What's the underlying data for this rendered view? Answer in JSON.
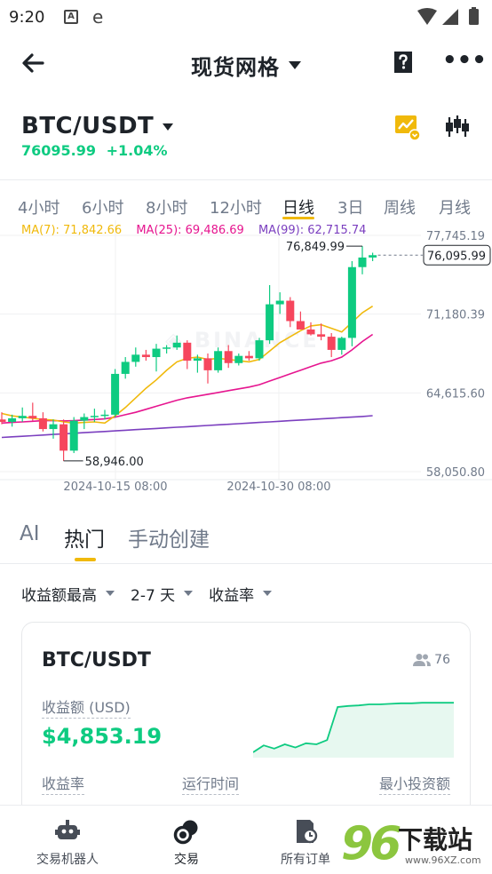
{
  "status_bar": {
    "time": "9:20",
    "icon_a": "A",
    "icon_e": "e"
  },
  "nav": {
    "title": "现货网格"
  },
  "pair": {
    "name": "BTC/USDT",
    "price": "76095.99",
    "change": "+1.04%"
  },
  "intervals": [
    "4小时",
    "6小时",
    "8小时",
    "12小时",
    "日线",
    "3日",
    "周线",
    "月线"
  ],
  "active_interval": "日线",
  "ma": {
    "ma7": "MA(7): 71,842.66",
    "ma25": "MA(25): 69,486.69",
    "ma99": "MA(99): 62,715.74",
    "colors": {
      "ma7": "#f0b90b",
      "ma25": "#e6158f",
      "ma99": "#7b3fbf"
    }
  },
  "chart_data": {
    "type": "candlestick",
    "y_ticks": [
      "77,745.19",
      "71,180.39",
      "64,615.60",
      "58,050.80"
    ],
    "x_ticks": [
      "2024-10-15 08:00",
      "2024-10-30 08:00"
    ],
    "high_label": "76,849.99",
    "low_label": "58,946.00",
    "last_price_label": "76,095.99",
    "watermark": "BINANCE",
    "ylim": [
      58050.8,
      77745.19
    ],
    "colors": {
      "up": "#0ecb81",
      "down": "#f6465d"
    },
    "candles": [
      {
        "o": 62400,
        "h": 63000,
        "l": 62000,
        "c": 62200
      },
      {
        "o": 62200,
        "h": 62800,
        "l": 61800,
        "c": 62500
      },
      {
        "o": 62500,
        "h": 63400,
        "l": 62200,
        "c": 62700
      },
      {
        "o": 62700,
        "h": 63800,
        "l": 62300,
        "c": 62500
      },
      {
        "o": 62500,
        "h": 63000,
        "l": 61400,
        "c": 61600
      },
      {
        "o": 61600,
        "h": 62400,
        "l": 60800,
        "c": 62000
      },
      {
        "o": 62000,
        "h": 62400,
        "l": 58946,
        "c": 59800
      },
      {
        "o": 59800,
        "h": 62600,
        "l": 59600,
        "c": 62300
      },
      {
        "o": 62300,
        "h": 62900,
        "l": 61600,
        "c": 62600
      },
      {
        "o": 62600,
        "h": 63300,
        "l": 62200,
        "c": 62700
      },
      {
        "o": 62700,
        "h": 63200,
        "l": 62400,
        "c": 62800
      },
      {
        "o": 62800,
        "h": 66600,
        "l": 62600,
        "c": 66200
      },
      {
        "o": 66200,
        "h": 67600,
        "l": 65800,
        "c": 67200
      },
      {
        "o": 67200,
        "h": 68400,
        "l": 66800,
        "c": 67800
      },
      {
        "o": 67800,
        "h": 68200,
        "l": 67300,
        "c": 67600
      },
      {
        "o": 67600,
        "h": 68700,
        "l": 66400,
        "c": 68300
      },
      {
        "o": 68300,
        "h": 68600,
        "l": 67900,
        "c": 68400
      },
      {
        "o": 68400,
        "h": 69400,
        "l": 68200,
        "c": 68800
      },
      {
        "o": 68800,
        "h": 69000,
        "l": 66600,
        "c": 67300
      },
      {
        "o": 67300,
        "h": 67800,
        "l": 66300,
        "c": 67500
      },
      {
        "o": 67500,
        "h": 67900,
        "l": 65400,
        "c": 66500
      },
      {
        "o": 66500,
        "h": 68400,
        "l": 66300,
        "c": 68100
      },
      {
        "o": 68100,
        "h": 68600,
        "l": 66700,
        "c": 67100
      },
      {
        "o": 67100,
        "h": 67900,
        "l": 66900,
        "c": 67700
      },
      {
        "o": 67700,
        "h": 68100,
        "l": 67300,
        "c": 67500
      },
      {
        "o": 67500,
        "h": 69200,
        "l": 67300,
        "c": 69000
      },
      {
        "o": 69000,
        "h": 73600,
        "l": 68700,
        "c": 72000
      },
      {
        "o": 72000,
        "h": 73000,
        "l": 71200,
        "c": 72300
      },
      {
        "o": 72300,
        "h": 72600,
        "l": 70100,
        "c": 70600
      },
      {
        "o": 70600,
        "h": 71400,
        "l": 69900,
        "c": 69900
      },
      {
        "o": 69900,
        "h": 70500,
        "l": 69400,
        "c": 69500
      },
      {
        "o": 69500,
        "h": 70400,
        "l": 69000,
        "c": 69300
      },
      {
        "o": 69300,
        "h": 69600,
        "l": 67600,
        "c": 68200
      },
      {
        "o": 68200,
        "h": 69300,
        "l": 67800,
        "c": 69200
      },
      {
        "o": 69200,
        "h": 75600,
        "l": 68500,
        "c": 75100
      },
      {
        "o": 75100,
        "h": 76849.99,
        "l": 74500,
        "c": 75900
      },
      {
        "o": 75900,
        "h": 76300,
        "l": 75600,
        "c": 76095.99
      }
    ],
    "ma7": [
      62900,
      62700,
      62600,
      62500,
      62400,
      62350,
      62200,
      62100,
      62150,
      62200,
      62100,
      62700,
      63400,
      64200,
      65000,
      65700,
      66500,
      67200,
      67500,
      67600,
      67400,
      67500,
      67400,
      67300,
      67200,
      67400,
      68100,
      68800,
      69300,
      69800,
      70200,
      70300,
      70000,
      69700,
      70500,
      71300,
      71842.66
    ],
    "ma25": [
      62100,
      62150,
      62200,
      62250,
      62300,
      62300,
      62280,
      62300,
      62350,
      62400,
      62450,
      62600,
      62800,
      63000,
      63250,
      63500,
      63750,
      64000,
      64200,
      64350,
      64500,
      64650,
      64800,
      64950,
      65100,
      65300,
      65600,
      65900,
      66200,
      66500,
      66800,
      67100,
      67300,
      67600,
      68200,
      68900,
      69486.69
    ],
    "ma99": [
      60900,
      60950,
      61000,
      61050,
      61100,
      61150,
      61200,
      61250,
      61300,
      61350,
      61400,
      61450,
      61500,
      61550,
      61600,
      61650,
      61700,
      61750,
      61800,
      61850,
      61900,
      61950,
      62000,
      62050,
      62100,
      62150,
      62200,
      62250,
      62300,
      62350,
      62400,
      62450,
      62500,
      62550,
      62600,
      62650,
      62715.74
    ]
  },
  "tabs": [
    "AI",
    "热门",
    "手动创建"
  ],
  "active_tab": "热门",
  "filters": [
    "收益额最高",
    "2-7 天",
    "收益率"
  ],
  "card": {
    "pair": "BTC/USDT",
    "users": "76",
    "profit_label": "收益额 (USD)",
    "profit_value": "$4,853.19",
    "stat_labels": [
      "收益率",
      "运行时间",
      "最小投资额"
    ],
    "spark": [
      0.05,
      0.18,
      0.12,
      0.2,
      0.14,
      0.22,
      0.2,
      0.28,
      0.9,
      0.92,
      0.93,
      0.95,
      0.95,
      0.96,
      0.97,
      0.97,
      0.98,
      0.98,
      0.98,
      0.98
    ]
  },
  "bottom_nav": [
    {
      "label": "交易机器人",
      "icon": "robot-icon"
    },
    {
      "label": "交易",
      "icon": "trade-icon"
    },
    {
      "label": "所有订单",
      "icon": "orders-icon"
    }
  ],
  "watermark": {
    "number": "96",
    "text": "下载站",
    "url": "www.96XZ.com"
  }
}
